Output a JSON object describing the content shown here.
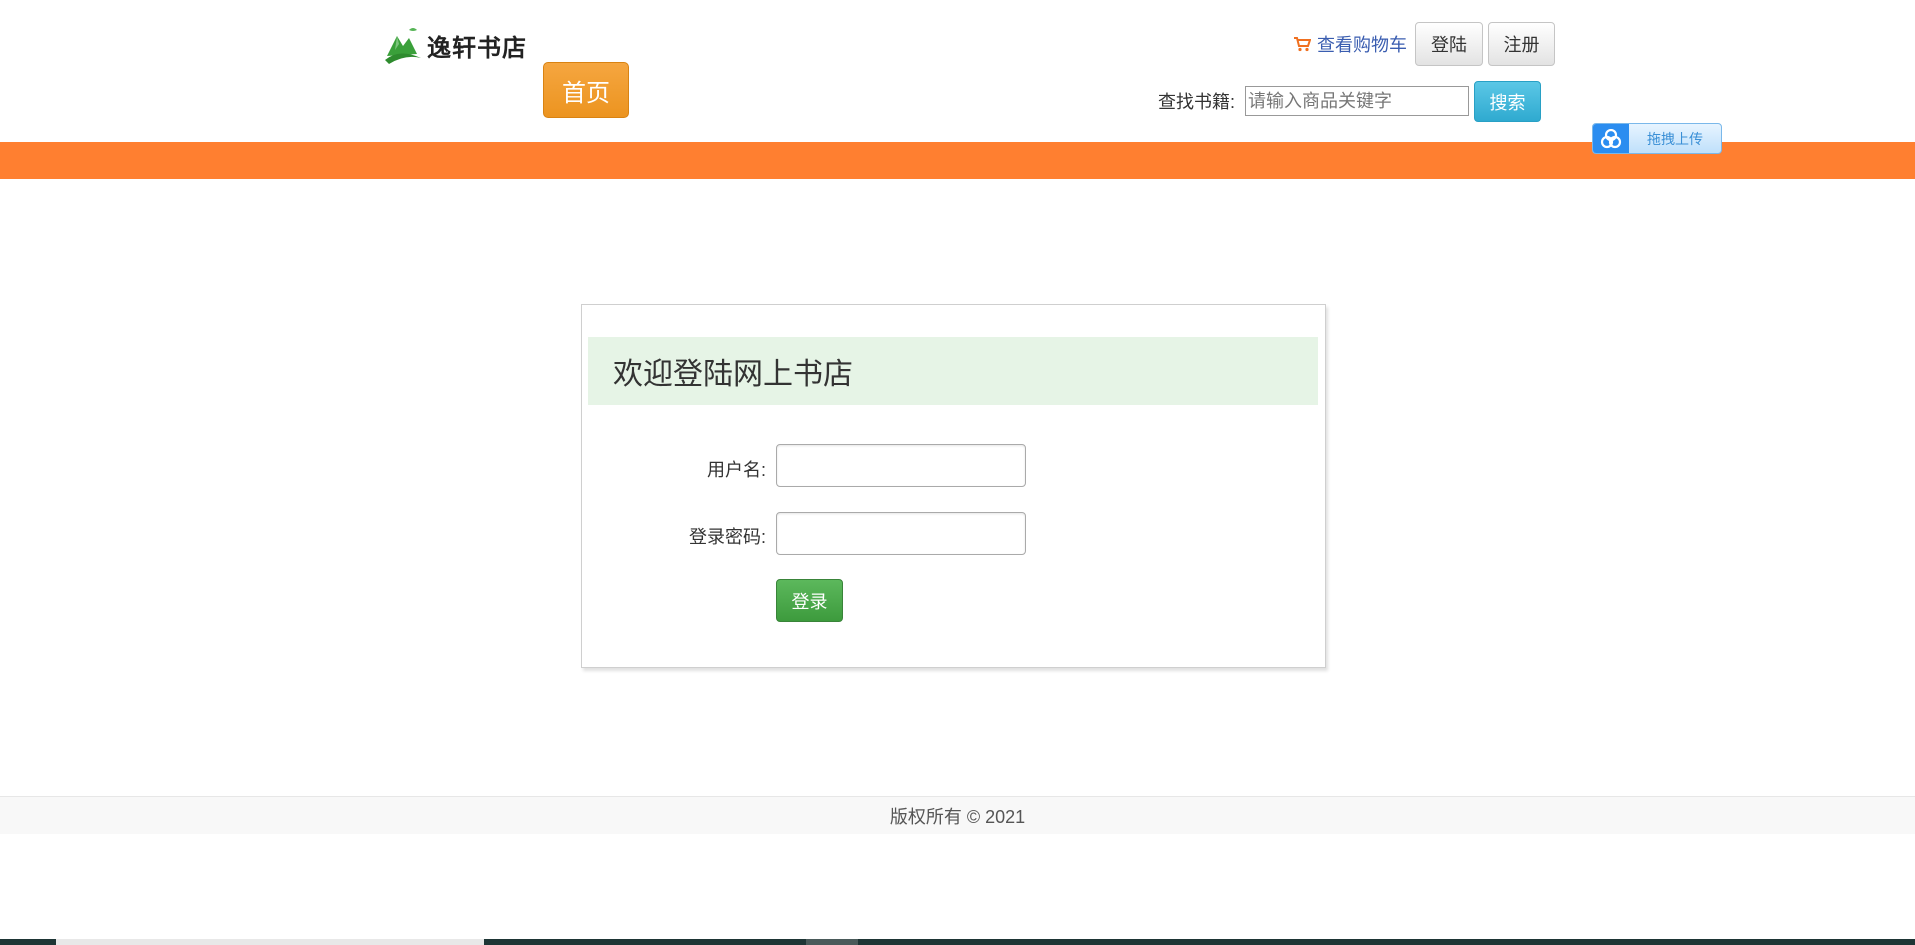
{
  "header": {
    "logo_text": "逸轩书店",
    "home_label": "首页",
    "cart_label": "查看购物车",
    "login_label": "登陆",
    "register_label": "注册",
    "search_label": "查找书籍:",
    "search_placeholder": "请输入商品关键字",
    "search_button": "搜索"
  },
  "baidu_upload": {
    "label": "拖拽上传"
  },
  "login_form": {
    "title": "欢迎登陆网上书店",
    "username_label": "用户名:",
    "username_value": "",
    "password_label": "登录密码:",
    "password_value": "",
    "submit_label": "登录"
  },
  "footer": {
    "copyright": "版权所有 © 2021"
  },
  "colors": {
    "accent_orange": "#ff7f30",
    "home_button": "#f0a030",
    "search_button": "#31b0d5",
    "login_button": "#4cae4c",
    "panel_header_bg": "#e6f4e6"
  },
  "icons": {
    "cart": "shopping-cart-icon",
    "logo": "mountain-leaf-logo",
    "baidu": "baidu-cloud-icon"
  }
}
